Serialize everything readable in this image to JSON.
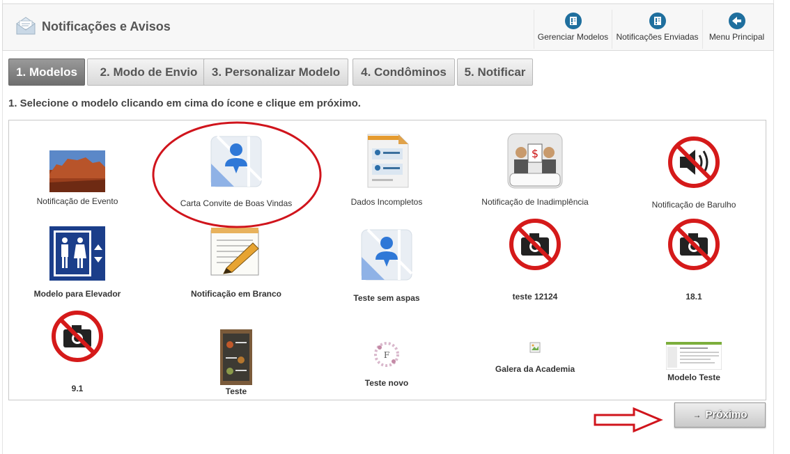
{
  "header": {
    "title": "Notificações e Avisos",
    "buttons": [
      {
        "label": "Gerenciar Modelos",
        "icon": "book-icon"
      },
      {
        "label": "Notificações Enviadas",
        "icon": "book-icon"
      },
      {
        "label": "Menu Principal",
        "icon": "arrow-left-icon"
      }
    ]
  },
  "tabs": [
    {
      "label": "1. Modelos",
      "active": true
    },
    {
      "label": "2. Modo de Envio",
      "active": false
    },
    {
      "label": "3. Personalizar Modelo",
      "active": false
    },
    {
      "label": "4. Condôminos",
      "active": false
    },
    {
      "label": "5. Notificar",
      "active": false
    }
  ],
  "instruction": "1. Selecione o modelo clicando em cima do ícone e clique em próximo.",
  "templates": [
    {
      "label": "Notificação de Evento",
      "icon": "landscape-photo"
    },
    {
      "label": "Carta Convite de Boas Vindas",
      "icon": "map-person-icon"
    },
    {
      "label": "Dados Incompletos",
      "icon": "document-form-icon"
    },
    {
      "label": "Notificação de Inadimplência",
      "icon": "debt-meeting-icon"
    },
    {
      "label": "Notificação de Barulho",
      "icon": "no-sound-icon"
    },
    {
      "label": "Modelo para Elevador",
      "icon": "elevator-icon"
    },
    {
      "label": "Notificação em Branco",
      "icon": "notepad-pencil-icon"
    },
    {
      "label": "Teste sem aspas",
      "icon": "map-person-icon"
    },
    {
      "label": "teste 12124",
      "icon": "no-camera-icon"
    },
    {
      "label": "18.1",
      "icon": "no-camera-icon"
    },
    {
      "label": "9.1",
      "icon": "no-camera-icon"
    },
    {
      "label": "Teste",
      "icon": "menu-photo"
    },
    {
      "label": "Teste novo",
      "icon": "floral-logo"
    },
    {
      "label": "Galera da Academia",
      "icon": "broken-image-icon"
    },
    {
      "label": "Modelo Teste",
      "icon": "screenshot-thumb"
    }
  ],
  "next_button": {
    "label": "Próximo"
  },
  "colors": {
    "accent_blue": "#1f6f9e",
    "active_tab": "#7f7f7f",
    "annotation_red": "#d0141c"
  }
}
